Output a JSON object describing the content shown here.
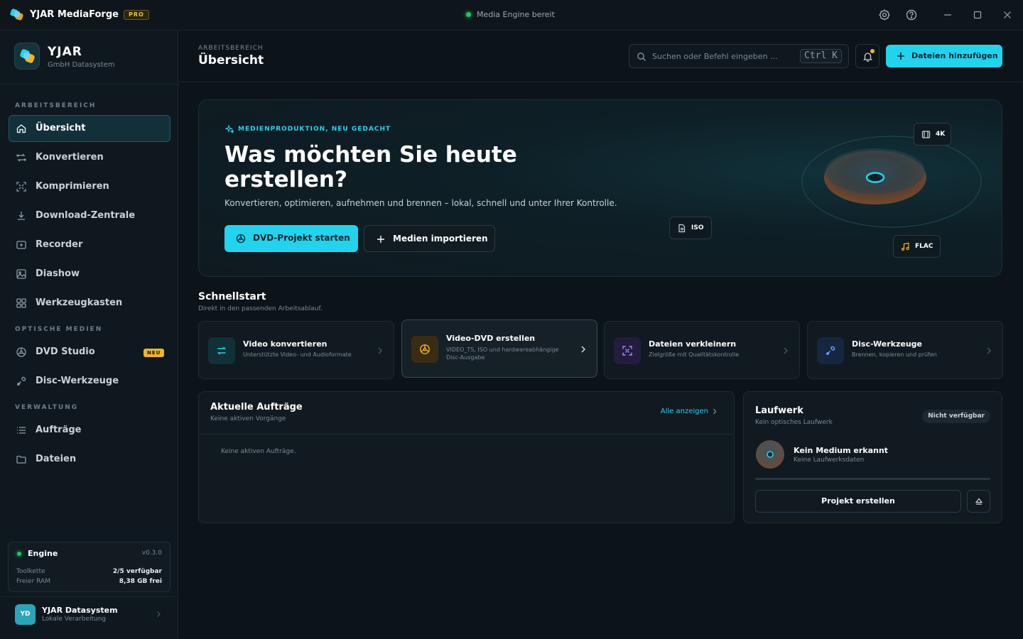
{
  "app": {
    "name": "YJAR MediaForge",
    "badge": "PRO",
    "status": "Media Engine bereit"
  },
  "brand": {
    "name": "YJAR",
    "sub": "GmbH Datasystem"
  },
  "sidebar": {
    "section_work": "ARBEITSBEREICH",
    "section_media": "OPTISCHE MEDIEN",
    "section_admin": "VERWALTUNG",
    "items": [
      {
        "label": "Übersicht",
        "icon": "home-icon"
      },
      {
        "label": "Konvertieren",
        "icon": "convert-icon"
      },
      {
        "label": "Komprimieren",
        "icon": "compress-icon"
      },
      {
        "label": "Download-Zentrale",
        "icon": "download-icon"
      },
      {
        "label": "Recorder",
        "icon": "recorder-icon"
      },
      {
        "label": "Diashow",
        "icon": "image-icon"
      },
      {
        "label": "Werkzeugkasten",
        "icon": "grid-icon"
      },
      {
        "label": "DVD Studio",
        "icon": "disc-icon",
        "badge": "NEU"
      },
      {
        "label": "Disc-Werkzeuge",
        "icon": "tool-icon"
      },
      {
        "label": "Aufträge",
        "icon": "list-icon"
      },
      {
        "label": "Dateien",
        "icon": "folder-icon"
      }
    ],
    "engine": {
      "title": "Engine",
      "version": "v0.3.0",
      "toolchain_label": "Toolkette",
      "toolchain_value": "2/5 verfügbar",
      "ram_label": "Freier RAM",
      "ram_value": "8,38 GB frei"
    },
    "user": {
      "initials": "YD",
      "name": "YJAR Datasystem",
      "sub": "Lokale Verarbeitung"
    }
  },
  "header": {
    "breadcrumb": "ARBEITSBEREICH",
    "title": "Übersicht",
    "search_placeholder": "Suchen oder Befehl eingeben ...",
    "shortcut": "Ctrl K",
    "add_label": "Dateien hinzufügen"
  },
  "hero": {
    "eyebrow": "MEDIENPRODUKTION, NEU GEDACHT",
    "title": "Was möchten Sie heute erstellen?",
    "lead": "Konvertieren, optimieren, aufnehmen und brennen – lokal, schnell und unter Ihrer Kontrolle.",
    "primary": "DVD-Projekt starten",
    "secondary": "Medien importieren",
    "chips": {
      "k4": "4K",
      "iso": "ISO",
      "flac": "FLAC"
    }
  },
  "quickstart": {
    "title": "Schnellstart",
    "sub": "Direkt in den passenden Arbeitsablauf.",
    "cards": [
      {
        "title": "Video konvertieren",
        "sub": "Unterstützte Video- und Audioformate"
      },
      {
        "title": "Video-DVD erstellen",
        "sub": "VIDEO_TS, ISO und hardwareabhängige Disc-Ausgabe"
      },
      {
        "title": "Dateien verkleinern",
        "sub": "Zielgröße mit Qualitätskontrolle"
      },
      {
        "title": "Disc-Werkzeuge",
        "sub": "Brennen, kopieren und prüfen"
      }
    ]
  },
  "orders": {
    "title": "Aktuelle Aufträge",
    "sub": "Keine aktiven Vorgänge",
    "link": "Alle anzeigen",
    "empty": "Keine aktiven Aufträge."
  },
  "drive": {
    "title": "Laufwerk",
    "sub": "Kein optisches Laufwerk",
    "badge": "Nicht verfügbar",
    "media_title": "Kein Medium erkannt",
    "media_sub": "Keine Laufwerksdaten",
    "button": "Projekt erstellen"
  },
  "colors": {
    "accent": "#22d3ee",
    "bg": "#0c1419",
    "warn": "#f0b429",
    "ok": "#22c55e"
  }
}
